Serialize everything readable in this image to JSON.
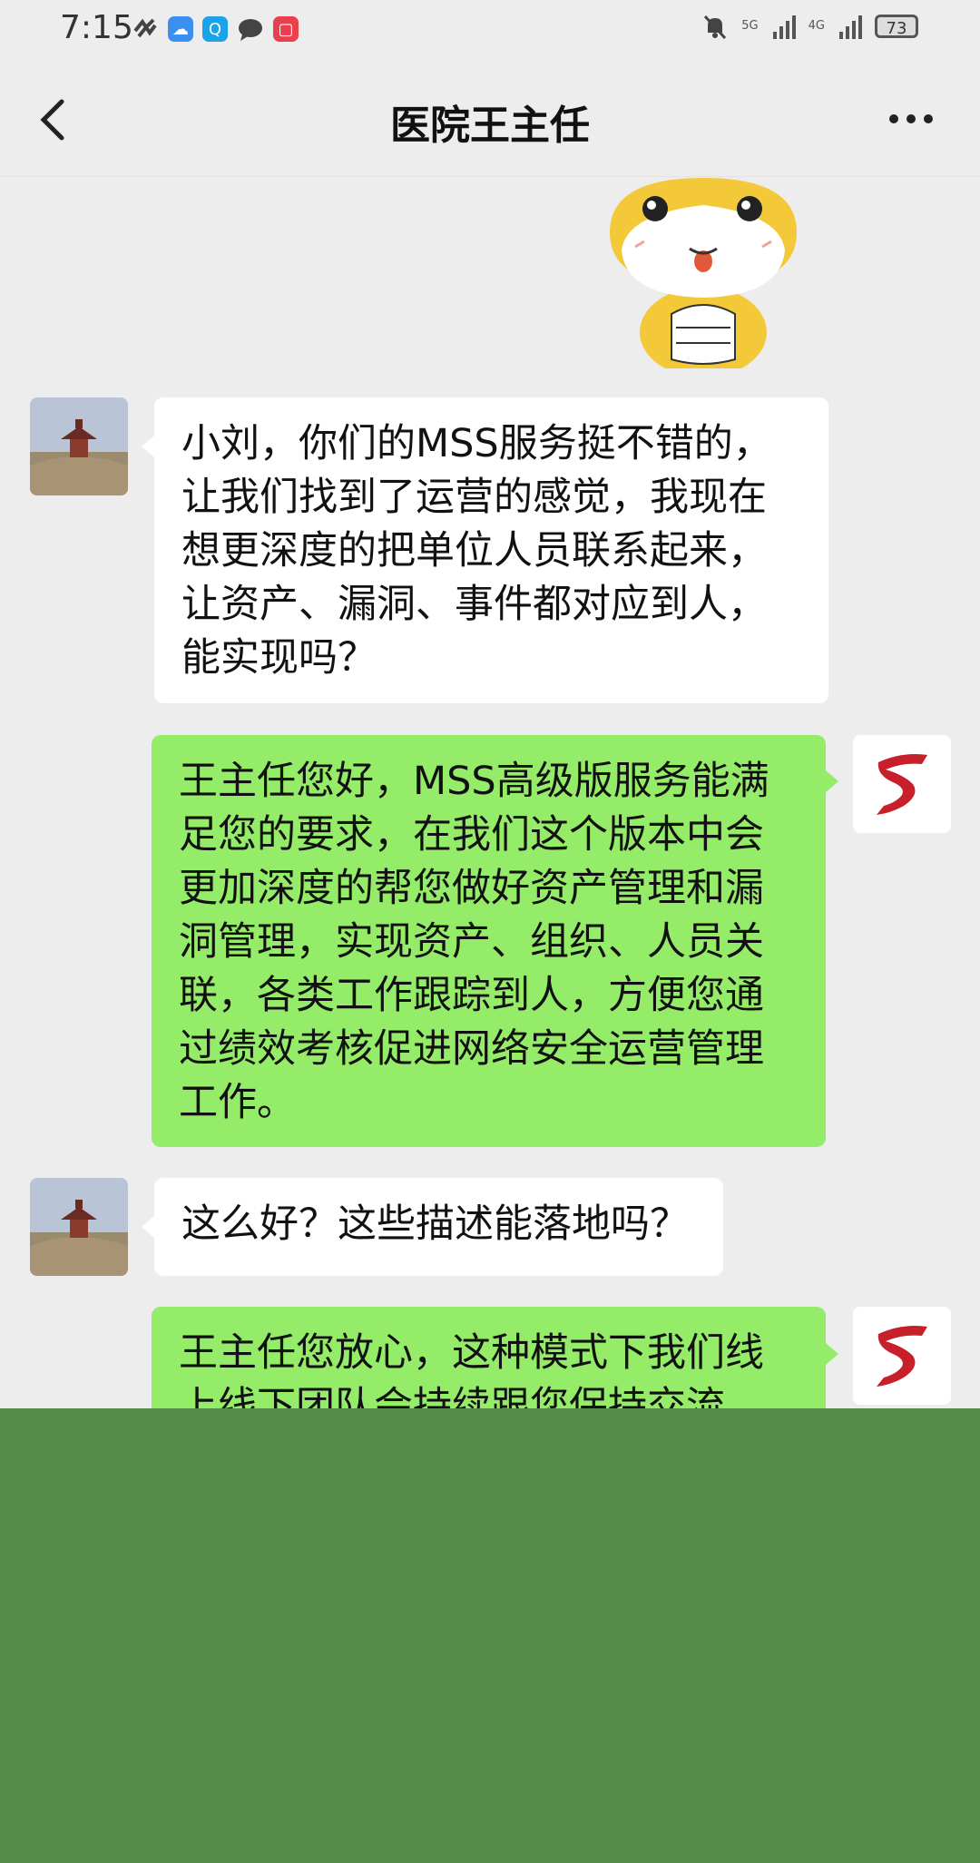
{
  "status": {
    "time": "7:15",
    "battery": "73",
    "net1": "5G",
    "net2": "4G"
  },
  "header": {
    "title": "医院王主任"
  },
  "messages": [
    {
      "side": "left",
      "text": "小刘，你们的MSS服务挺不错的，让我们找到了运营的感觉，我现在想更深度的把单位人员联系起来，让资产、漏洞、事件都对应到人，能实现吗？"
    },
    {
      "side": "right",
      "text": "王主任您好，MSS高级版服务能满足您的要求，在我们这个版本中会更加深度的帮您做好资产管理和漏洞管理，实现资产、组织、人员关联，各类工作跟踪到人，方便您通过绩效考核促进网络安全运营管理工作。"
    },
    {
      "side": "left",
      "text": "这么好？这些描述能落地吗？"
    },
    {
      "side": "right",
      "text": "王主任您放心，这种模式下我们线上线下团队会持续跟您保持交流"
    }
  ],
  "colors": {
    "bubble_right": "#95ec69",
    "bubble_left": "#ffffff",
    "overlay": "#528c46",
    "background": "#ededed"
  }
}
